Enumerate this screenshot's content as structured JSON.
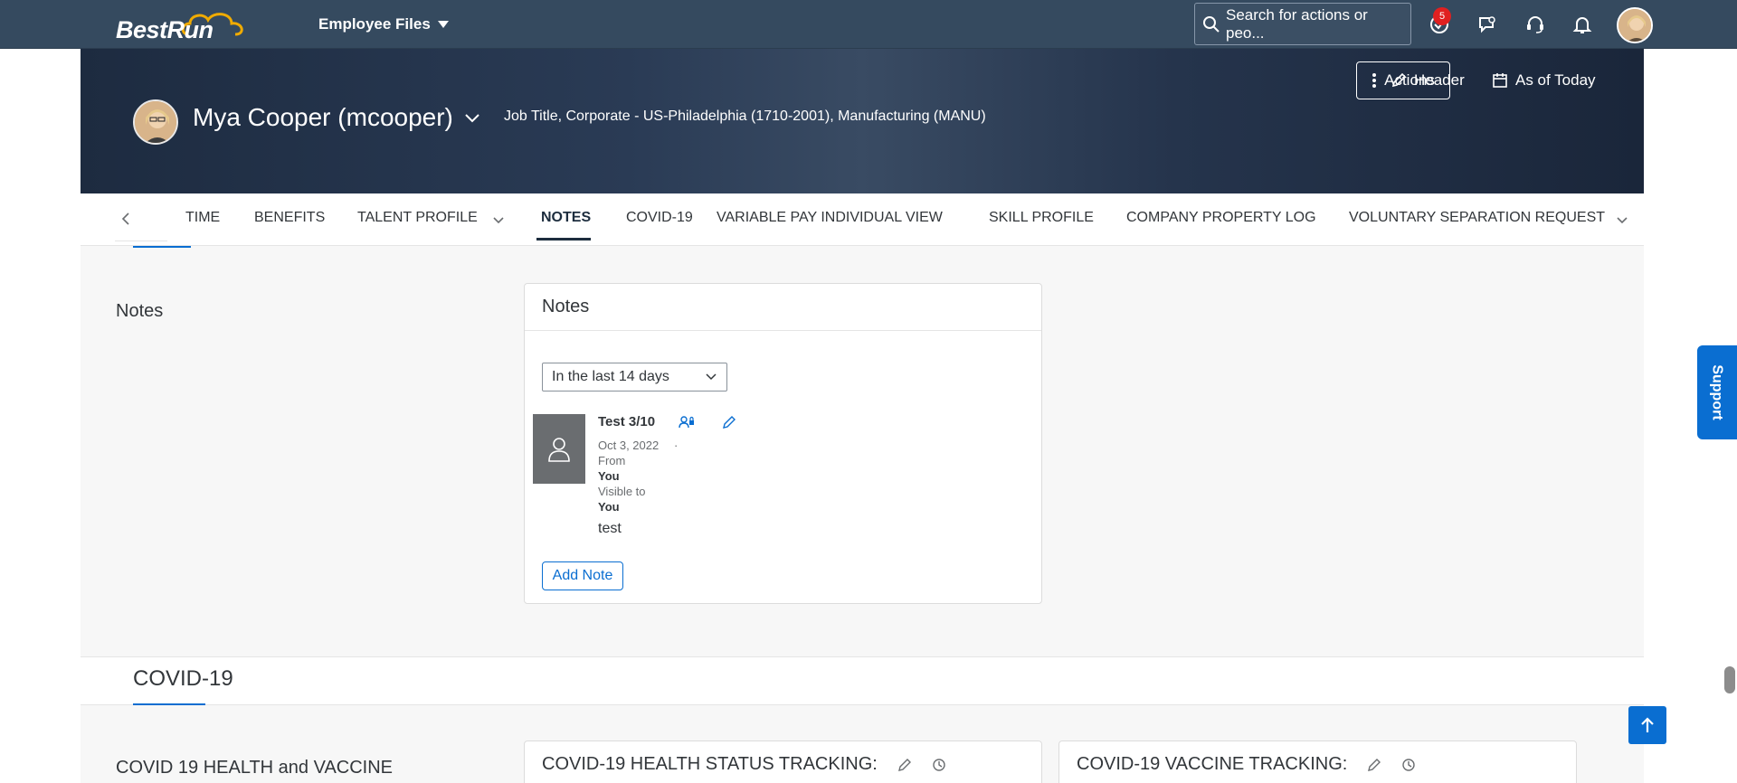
{
  "shell": {
    "logo": "BestRun",
    "module": "Employee Files",
    "search_placeholder": "Search for actions or peo...",
    "notification_count": "5"
  },
  "header": {
    "actions_label": "Actions",
    "header_label": "Header",
    "as_of_label": "As of Today",
    "name": "Mya Cooper (mcooper)",
    "meta": "Job Title, Corporate - US-Philadelphia (1710-2001), Manufacturing (MANU)"
  },
  "tabs": [
    {
      "label": "TIME"
    },
    {
      "label": "BENEFITS"
    },
    {
      "label": "TALENT PROFILE"
    },
    {
      "label": "NOTES"
    },
    {
      "label": "COVID-19"
    },
    {
      "label": "VARIABLE PAY INDIVIDUAL VIEW"
    },
    {
      "label": "SKILL PROFILE"
    },
    {
      "label": "COMPANY PROPERTY LOG"
    },
    {
      "label": "VOLUNTARY SEPARATION REQUEST"
    }
  ],
  "notes_section": {
    "section_label": "Notes",
    "card_title": "Notes",
    "filter_value": "In the last 14 days",
    "note": {
      "title": "Test 3/10",
      "date": "Oct 3, 2022",
      "separator": "·",
      "from_label": "From",
      "from_value": "You",
      "visible_label": "Visible to",
      "visible_value": "You",
      "body": "test"
    },
    "add_note_label": "Add Note"
  },
  "covid_section": {
    "title": "COVID-19",
    "left_label": "COVID 19 HEALTH and VACCINE",
    "card1_title": "COVID-19 HEALTH STATUS TRACKING:",
    "card2_title": "COVID-19 VACCINE TRACKING:"
  },
  "support_label": "Support",
  "colors": {
    "shell": "#354a5f",
    "accent": "#0a6ed1",
    "badge": "#e02020"
  }
}
